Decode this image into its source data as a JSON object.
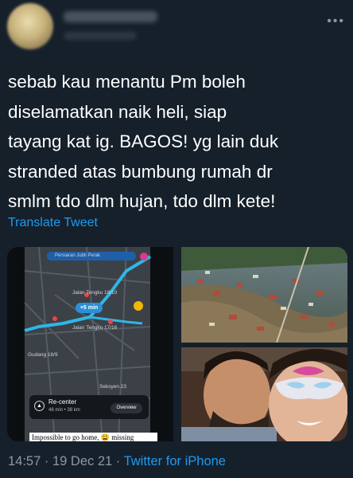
{
  "tweet": {
    "text": "sebab kau menantu Pm boleh\ndiselamatkan naik heli, siap\ntayang kat ig. BAGOS! yg lain duk\nstranded atas bumbung rumah dr\nsmlm tdo dlm hujan, tdo dlm kete!",
    "translate_label": "Translate Tweet",
    "time": "14:57",
    "date": "19 Dec 21",
    "source": "Twitter for iPhone"
  },
  "map": {
    "top_label": "Persiaran Jubli Perak",
    "eta": "+5 min",
    "street_1": "Jalan Tengku 18/10",
    "street_2": "Jalan Tengku 17/16",
    "street_3": "Gudang 16/9",
    "street_4": "Seksyen 23",
    "recenter_label": "Re-center",
    "recenter_sub": "48 min • 38 km",
    "overview_label": "Overview",
    "caption": "Impossible to go home, 😩 missing"
  },
  "icons": {
    "more": "more-options-icon",
    "navigation": "navigation-icon",
    "search": "search-icon"
  },
  "colors": {
    "background": "#15202b",
    "link": "#1d9bf0",
    "secondary_text": "#8b98a5",
    "route": "#2fb6e6"
  }
}
